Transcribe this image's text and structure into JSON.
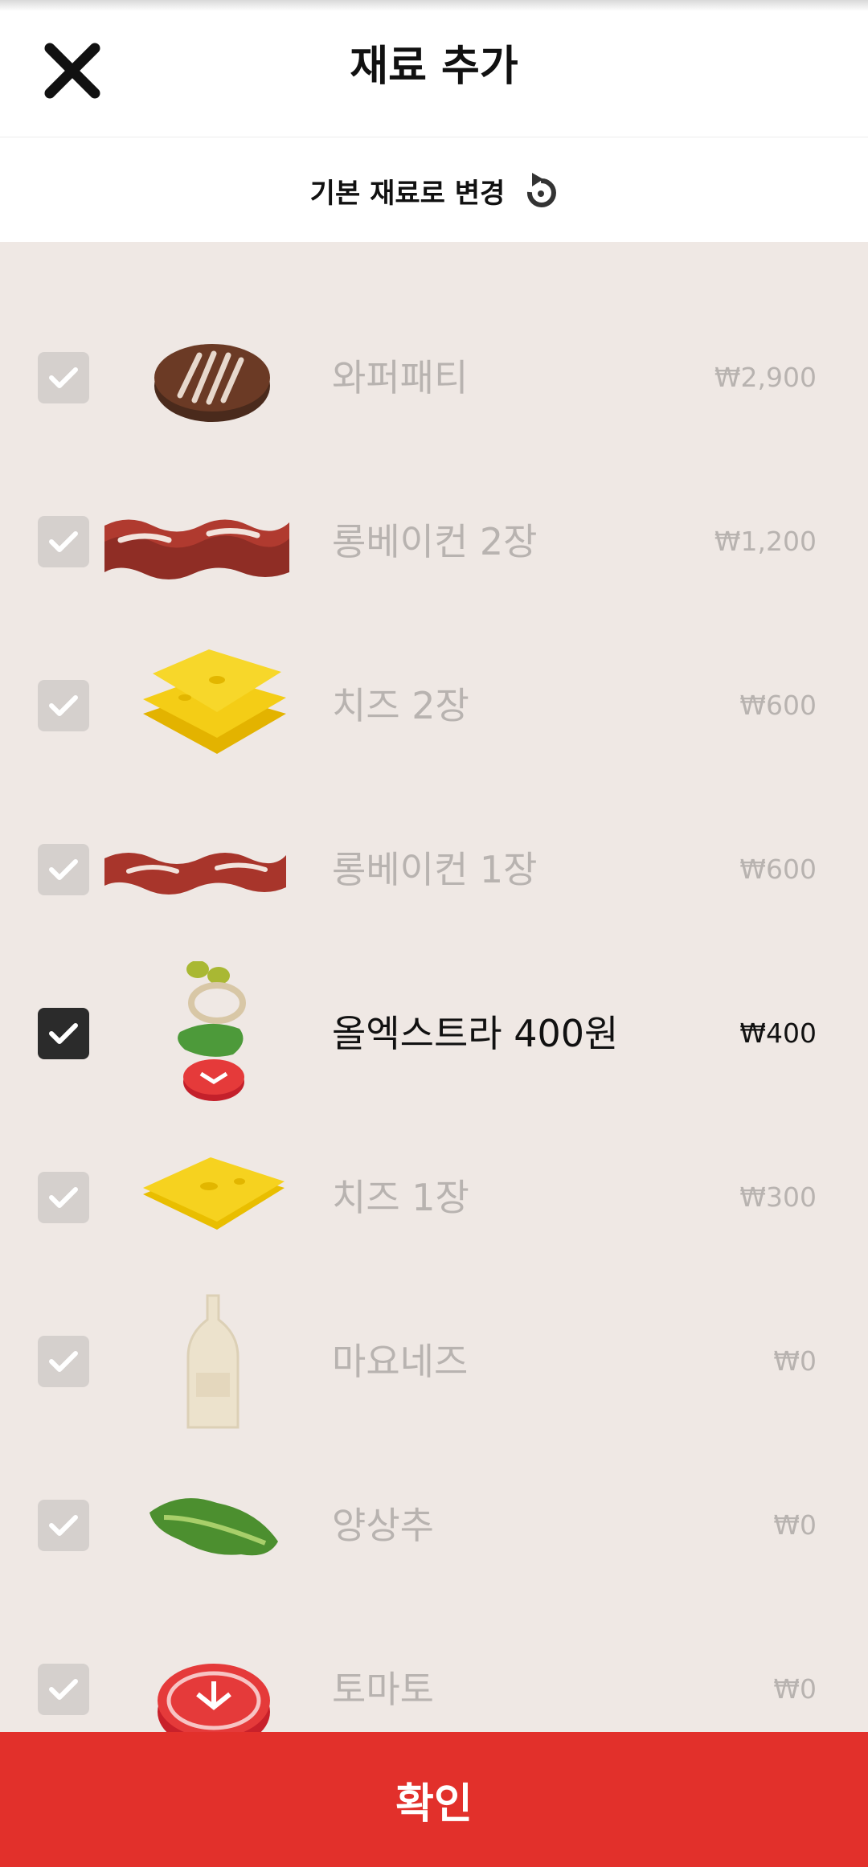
{
  "header": {
    "title": "재료 추가",
    "close_icon": "close-icon"
  },
  "reset": {
    "label": "기본 재료로 변경",
    "icon": "reset-icon"
  },
  "colors": {
    "accent": "#e2302b",
    "list_bg": "#efe8e4",
    "checked": "#2b2b2b",
    "unchecked": "#d5d0cd",
    "muted_text": "#b8b3b0"
  },
  "items": [
    {
      "name": "와퍼패티",
      "price": "₩2,900",
      "checked": false,
      "icon": "patty-icon"
    },
    {
      "name": "롱베이컨 2장",
      "price": "₩1,200",
      "checked": false,
      "icon": "bacon-double-icon"
    },
    {
      "name": "치즈 2장",
      "price": "₩600",
      "checked": false,
      "icon": "cheese-double-icon"
    },
    {
      "name": "롱베이컨 1장",
      "price": "₩600",
      "checked": false,
      "icon": "bacon-icon"
    },
    {
      "name": "올엑스트라 400원",
      "price": "₩400",
      "checked": true,
      "icon": "all-extra-icon"
    },
    {
      "name": "치즈 1장",
      "price": "₩300",
      "checked": false,
      "icon": "cheese-icon"
    },
    {
      "name": "마요네즈",
      "price": "₩0",
      "checked": false,
      "icon": "mayo-bottle-icon"
    },
    {
      "name": "양상추",
      "price": "₩0",
      "checked": false,
      "icon": "lettuce-icon"
    },
    {
      "name": "토마토",
      "price": "₩0",
      "checked": false,
      "icon": "tomato-icon"
    }
  ],
  "footer": {
    "confirm_label": "확인"
  }
}
